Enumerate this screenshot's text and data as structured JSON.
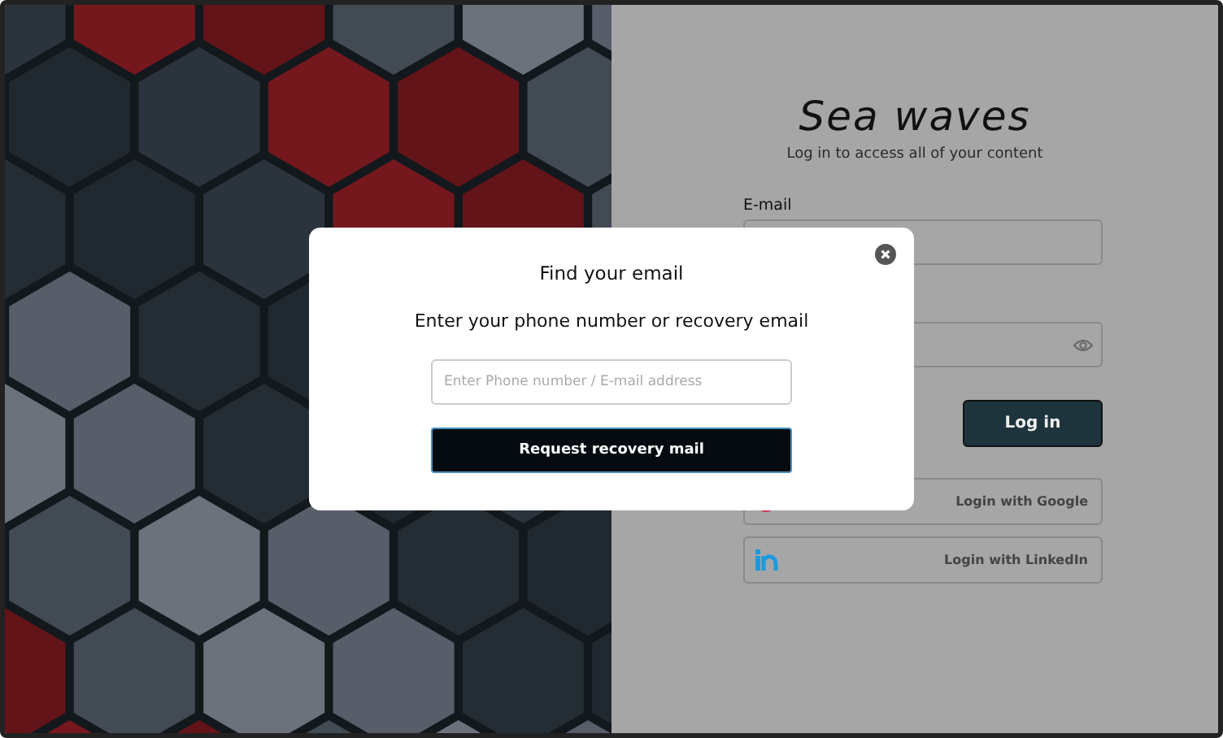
{
  "login": {
    "title": "Sea waves",
    "subtitle": "Log in to access all of your content",
    "email_label": "E-mail",
    "login_button": "Log in",
    "social_buttons": [
      {
        "kind": "google",
        "label": "Login with Google"
      },
      {
        "kind": "linkedin",
        "label": "Login with LinkedIn"
      }
    ]
  },
  "dialog": {
    "title": "Find your email",
    "prompt": "Enter your phone number or recovery email",
    "field": {
      "placeholder": "Enter Phone number / E-mail address"
    },
    "submit": "Request recovery mail"
  }
}
